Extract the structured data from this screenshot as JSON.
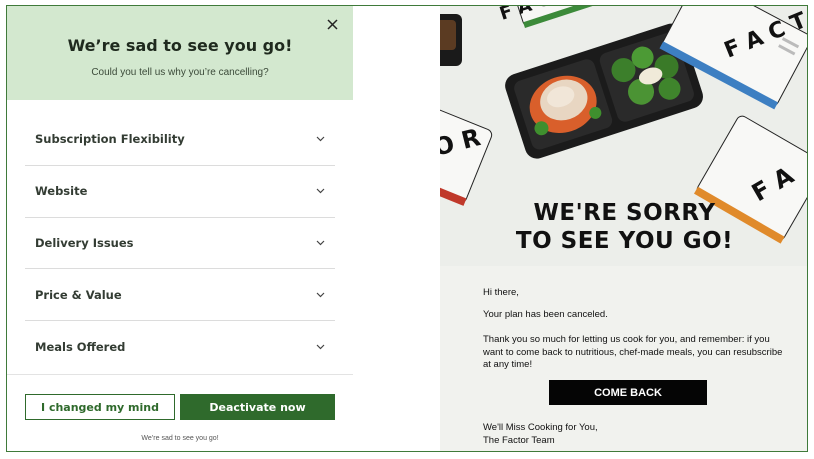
{
  "modal": {
    "title": "We’re sad to see you go!",
    "subtitle": "Could you tell us why you’re cancelling?",
    "reasons": [
      {
        "label": "Subscription Flexibility"
      },
      {
        "label": "Website"
      },
      {
        "label": "Delivery Issues"
      },
      {
        "label": "Price & Value"
      },
      {
        "label": "Meals Offered"
      }
    ],
    "changed_mind_label": "I changed my mind",
    "deactivate_label": "Deactivate now",
    "footer_note": "We’re sad to see you go!"
  },
  "email": {
    "brand_text": "FACTOR",
    "headline_line1": "WE'RE SORRY",
    "headline_line2": "TO SEE YOU GO!",
    "greeting": "Hi there,",
    "plan_status": "Your plan has been canceled.",
    "message": "Thank you so much for letting us cook for you, and remember: if you want to come back to nutritious, chef-made meals, you can resubscribe at any time!",
    "cta_label": "COME BACK",
    "signoff_line1": "We'll Miss Cooking for You,",
    "signoff_line2": "The Factor Team"
  },
  "colors": {
    "accent_green": "#2f6a2c",
    "header_green": "#d3e8cf",
    "frame_border": "#3f7a3a",
    "cta_black": "#050505"
  },
  "icons": {
    "close": "close-icon",
    "chevron": "chevron-down-icon"
  }
}
